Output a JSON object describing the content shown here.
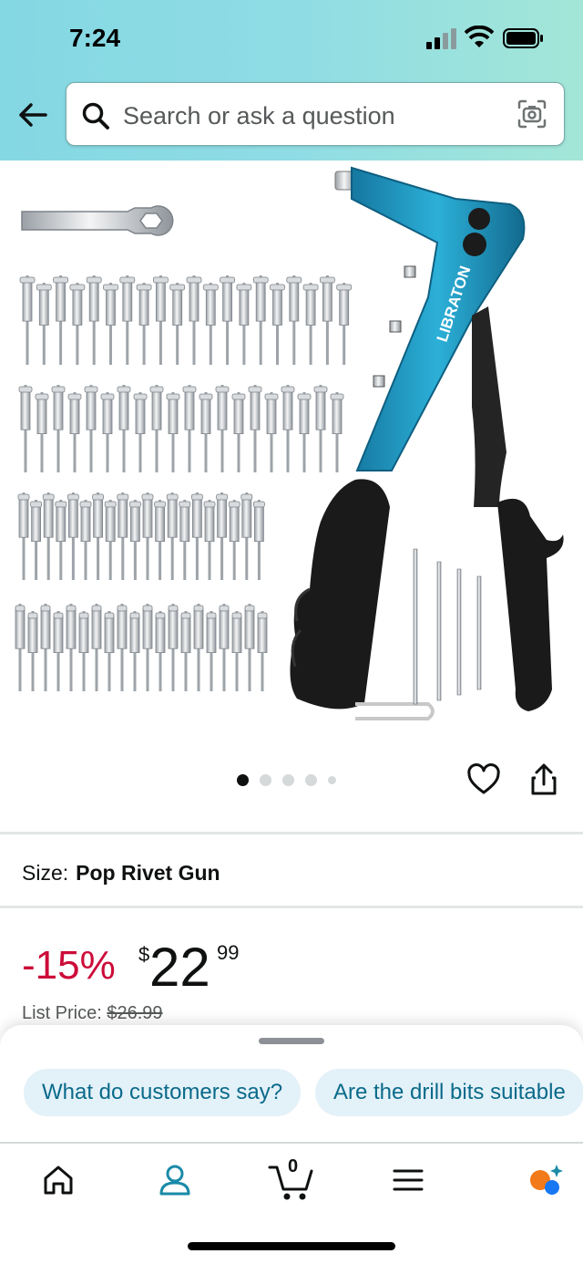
{
  "status_bar": {
    "time": "7:24"
  },
  "search": {
    "placeholder": "Search or ask a question"
  },
  "hero": {
    "brand_text": "LIBRATON",
    "image_count": 5,
    "active_index": 0
  },
  "size": {
    "label": "Size:",
    "value": "Pop Rivet Gun"
  },
  "price": {
    "discount": "-15%",
    "currency": "$",
    "whole": "22",
    "fraction": "99",
    "list_label": "List Price:",
    "list_value": "$26.99"
  },
  "chips": [
    "What do customers say?",
    "Are the drill bits suitable"
  ],
  "nav": {
    "cart_count": "0"
  },
  "colors": {
    "accent_teal": "#1a8aa8",
    "discount_red": "#cc0c39",
    "gun_blue": "#1e9bc0"
  }
}
